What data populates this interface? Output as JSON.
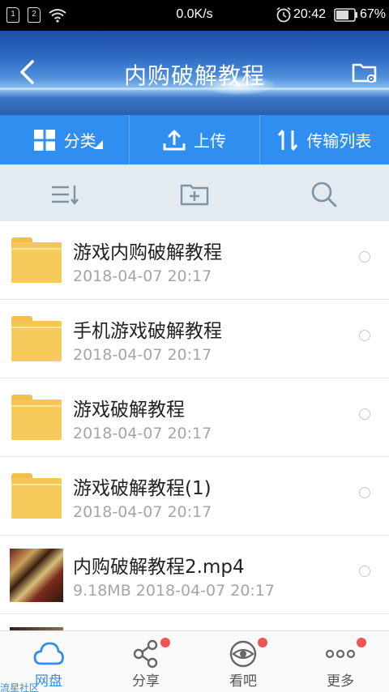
{
  "status_bar": {
    "sim1": "1",
    "sim2": "2",
    "network_speed": "0.0K/s",
    "time": "20:42",
    "battery": "67%"
  },
  "header": {
    "title": "内购破解教程",
    "back_icon": "chevron-left-icon",
    "settings_icon": "folder-settings-icon"
  },
  "actions": {
    "category": "分类",
    "upload": "上传",
    "transfer_list": "传输列表"
  },
  "toolbar": {
    "sort_icon": "sort-icon",
    "new_folder_icon": "folder-plus-icon",
    "search_icon": "search-icon"
  },
  "files": [
    {
      "name": "游戏内购破解教程",
      "meta": "2018-04-07  20:17",
      "type": "folder"
    },
    {
      "name": "手机游戏破解教程",
      "meta": "2018-04-07  20:17",
      "type": "folder"
    },
    {
      "name": "游戏破解教程",
      "meta": "2018-04-07  20:17",
      "type": "folder"
    },
    {
      "name": "游戏破解教程(1)",
      "meta": "2018-04-07  20:17",
      "type": "folder"
    },
    {
      "name": "内购破解教程2.mp4",
      "meta": "9.18MB  2018-04-07  20:17",
      "type": "video"
    }
  ],
  "nav": [
    {
      "label": "网盘",
      "icon": "cloud-icon",
      "active": true,
      "badge": false
    },
    {
      "label": "分享",
      "icon": "share-icon",
      "active": false,
      "badge": true
    },
    {
      "label": "看吧",
      "icon": "eye-icon",
      "active": false,
      "badge": true
    },
    {
      "label": "更多",
      "icon": "more-icon",
      "active": false,
      "badge": true
    }
  ],
  "watermark": "流星社区",
  "colors": {
    "accent": "#2f8ef0",
    "badge": "#f05454",
    "folder": "#f5c654"
  }
}
